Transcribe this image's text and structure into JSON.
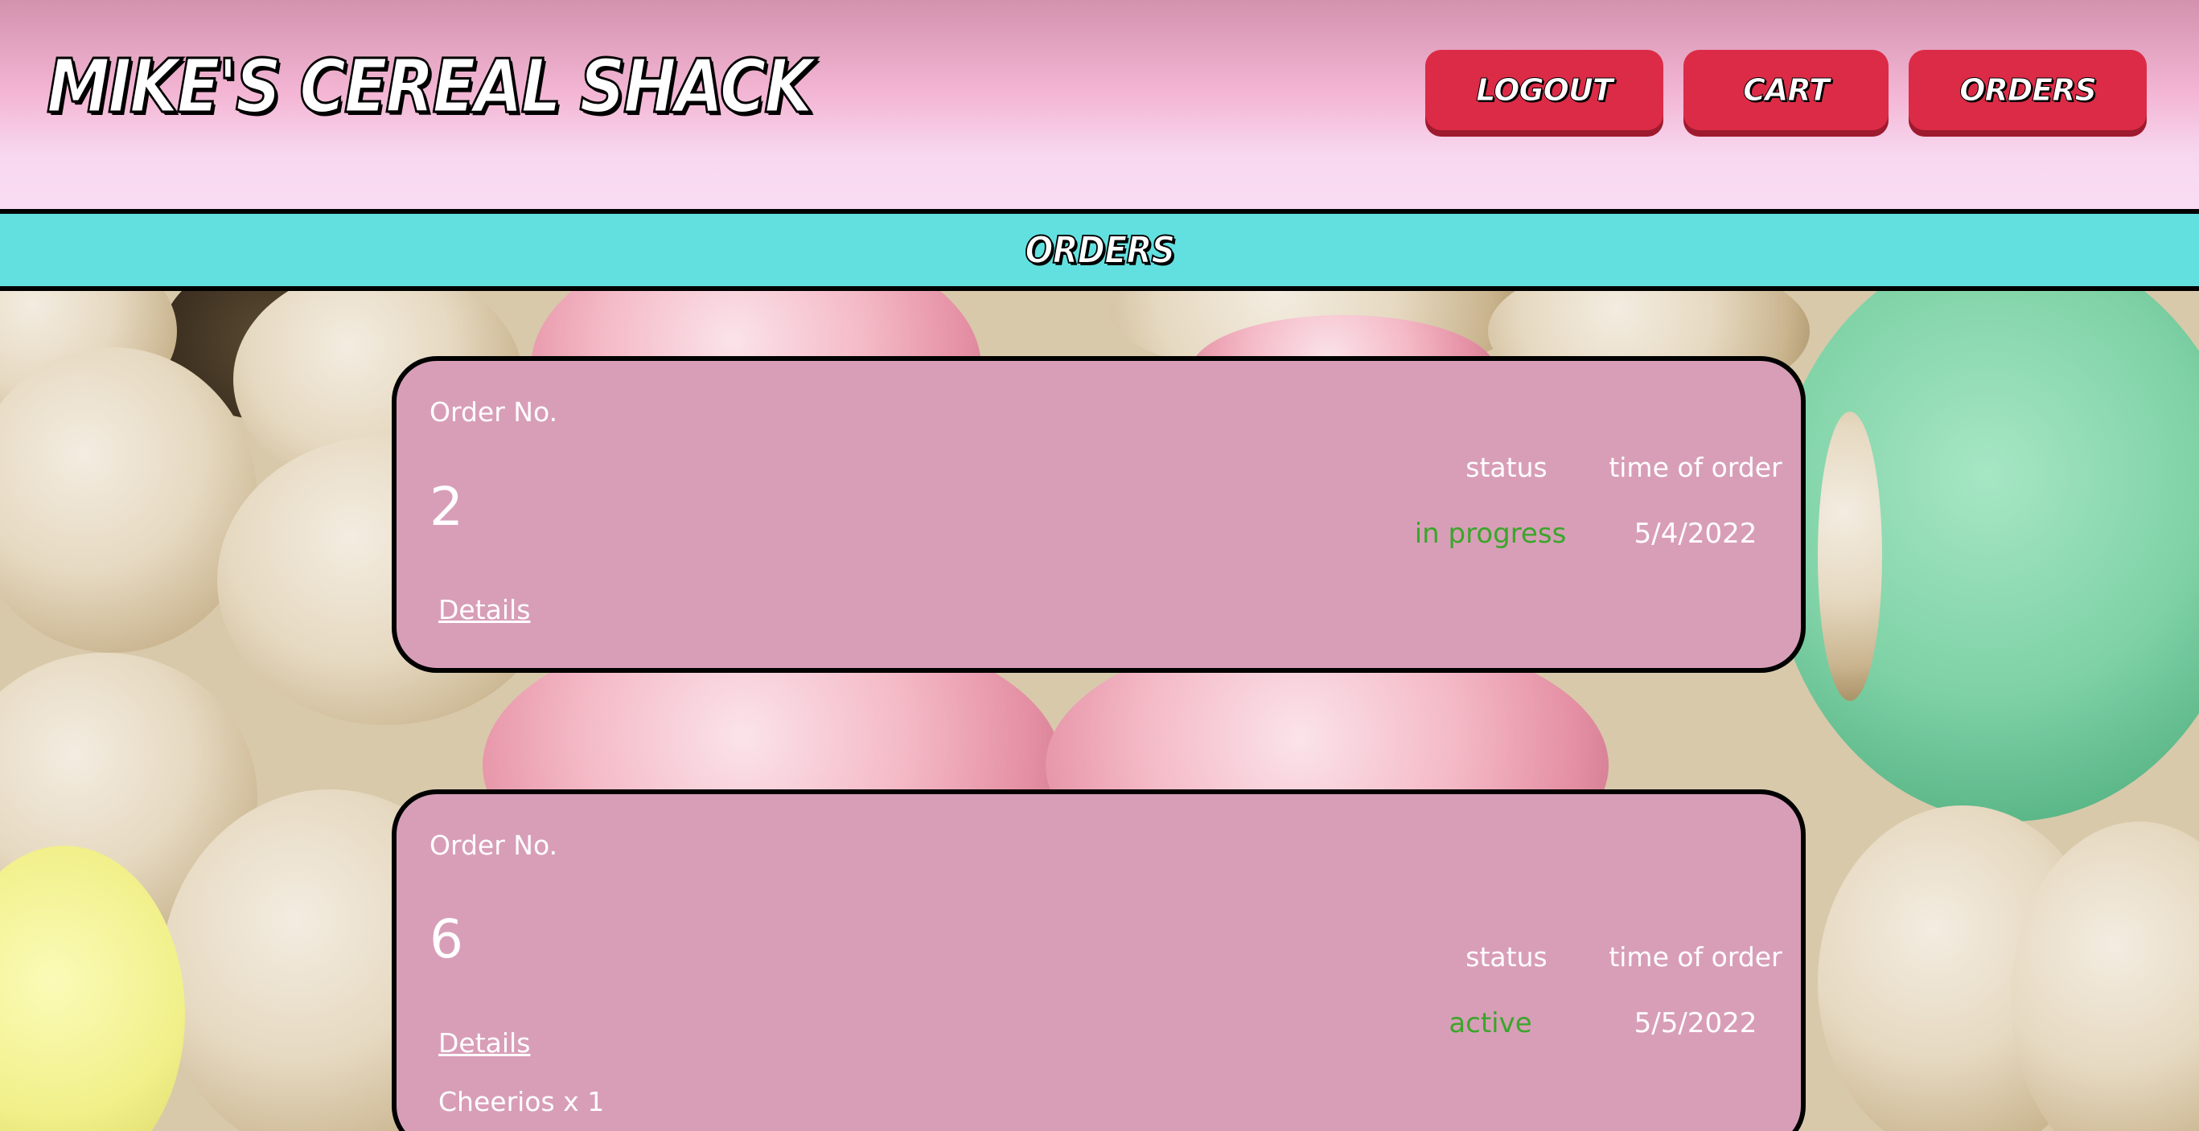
{
  "header": {
    "brand": "MIKE'S CEREAL SHACK",
    "nav": {
      "logout": "LOGOUT",
      "cart": "CART",
      "orders": "ORDERS"
    }
  },
  "page": {
    "title": "ORDERS"
  },
  "orders": [
    {
      "label": "Order No.",
      "number": "2",
      "details_link": "Details",
      "status_header": "status",
      "status": "in progress",
      "time_header": "time of order",
      "time": "5/4/2022",
      "items": []
    },
    {
      "label": "Order No.",
      "number": "6",
      "details_link": "Details",
      "status_header": "status",
      "status": "active",
      "time_header": "time of order",
      "time": "5/5/2022",
      "items": [
        "Cheerios x 1"
      ]
    }
  ],
  "colors": {
    "header_top": "#d392ae",
    "header_bottom": "#f9dcf3",
    "button": "#dc2b46",
    "title_bar": "#62e0e0",
    "card": "#d89eb8",
    "status": "#3aa62a"
  }
}
